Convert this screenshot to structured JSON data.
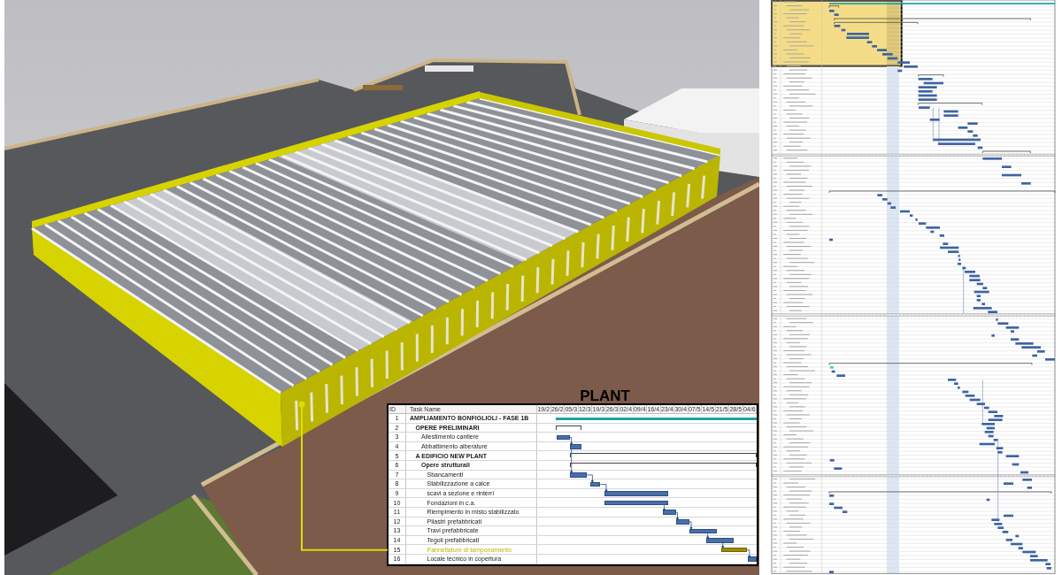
{
  "inset": {
    "title": "PLANT",
    "id_header": "ID",
    "name_header": "Task Name",
    "dates": [
      "19/2",
      "26/2",
      "05/3",
      "12/3",
      "19/3",
      "26/3",
      "02/4",
      "09/4",
      "16/4",
      "23/4",
      "30/4",
      "07/5",
      "14/5",
      "21/5",
      "28/5",
      "04/6"
    ],
    "tasks": [
      {
        "id": "1",
        "name": "AMPLIAMENTO BONFIGLIOLI - FASE 1B",
        "kind": "project",
        "highlighted": false,
        "children": [
          {
            "id": "2",
            "name": "OPERE PRELIMINARI",
            "kind": "summary",
            "highlighted": false,
            "children": [
              {
                "id": "3",
                "name": "Allestimento cantiere",
                "kind": "task",
                "highlighted": false
              },
              {
                "id": "4",
                "name": "Abbattimento alberature",
                "kind": "task",
                "highlighted": false
              }
            ]
          },
          {
            "id": "5",
            "name": "A EDIFICIO NEW PLANT",
            "kind": "summary",
            "highlighted": false,
            "children": [
              {
                "id": "6",
                "name": "Opere strutturali",
                "kind": "summary",
                "highlighted": false,
                "children": [
                  {
                    "id": "7",
                    "name": "Sbancamenti",
                    "kind": "task",
                    "highlighted": false
                  },
                  {
                    "id": "8",
                    "name": "Stabilizzazione a calce",
                    "kind": "task",
                    "highlighted": false
                  },
                  {
                    "id": "9",
                    "name": "scavi a sezione e rinterri",
                    "kind": "task",
                    "highlighted": false
                  },
                  {
                    "id": "10",
                    "name": "Fondazioni in c.a.",
                    "kind": "task",
                    "highlighted": false
                  },
                  {
                    "id": "11",
                    "name": "Riempimento in misto stabilizzato",
                    "kind": "task",
                    "highlighted": false
                  },
                  {
                    "id": "12",
                    "name": "Pilastri prefabbricati",
                    "kind": "task",
                    "highlighted": false
                  },
                  {
                    "id": "13",
                    "name": "Travi prefabbricate",
                    "kind": "task",
                    "highlighted": false
                  },
                  {
                    "id": "14",
                    "name": "Tegoli prefabbricati",
                    "kind": "task",
                    "highlighted": false
                  },
                  {
                    "id": "15",
                    "name": "Pannellature di tamponamento",
                    "kind": "task",
                    "highlighted": true
                  },
                  {
                    "id": "16",
                    "name": "Locale tecnico in copertura",
                    "kind": "task",
                    "highlighted": false
                  }
                ]
              }
            ]
          }
        ]
      }
    ]
  }
}
